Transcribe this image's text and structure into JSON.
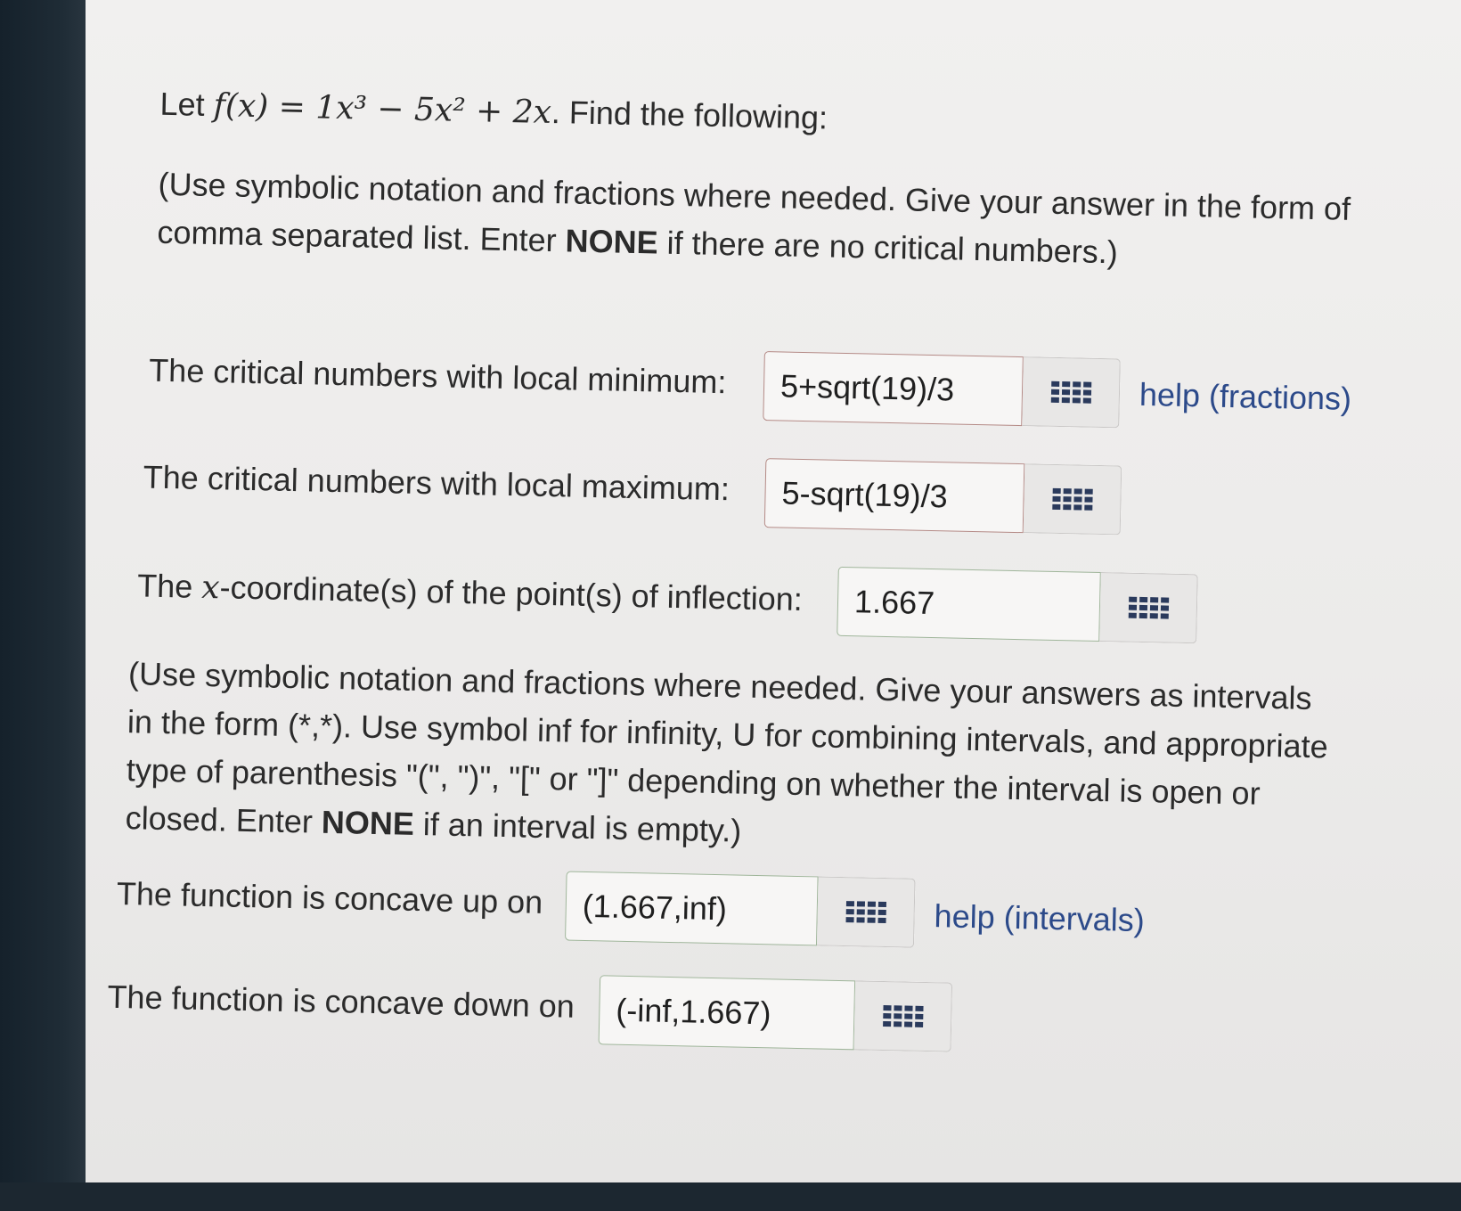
{
  "problem": {
    "prefix": "Let",
    "formula": "f(x) = 1x³ − 5x² + 2x",
    "suffix": ". Find the following:"
  },
  "instructions_1": {
    "part1": "(Use symbolic notation and fractions where needed. Give your answer in the form of comma separated list. Enter ",
    "bold": "NONE",
    "part2": " if there are no critical numbers.)"
  },
  "questions": [
    {
      "label": "The critical numbers with local minimum:",
      "value": "5+sqrt(19)/3",
      "help": "help (fractions)"
    },
    {
      "label": "The critical numbers with local maximum:",
      "value": "5-sqrt(19)/3"
    },
    {
      "label_pre": "The ",
      "label_math": "x",
      "label_post": "-coordinate(s) of the point(s) of inflection:",
      "value": "1.667"
    }
  ],
  "instructions_2": {
    "part1": "(Use symbolic notation and fractions where needed. Give your answers as intervals in the form (*,*). Use symbol inf for infinity, U for combining intervals, and appropriate type of parenthesis \"(\", \")\", \"[\" or \"]\" depending on whether the interval is open or closed. Enter ",
    "bold": "NONE",
    "part2": " if an interval is empty.)"
  },
  "intervals": [
    {
      "label": "The function is concave up on",
      "value": "(1.667,inf)",
      "help": "help (intervals)"
    },
    {
      "label": "The function is concave down on",
      "value": "(-inf,1.667)"
    }
  ],
  "icons": {
    "keyboard": "keyboard-grid-icon"
  },
  "colors": {
    "link": "#2c4a8a",
    "wrong_border": "#b48a86",
    "right_border": "#9fb59a"
  }
}
